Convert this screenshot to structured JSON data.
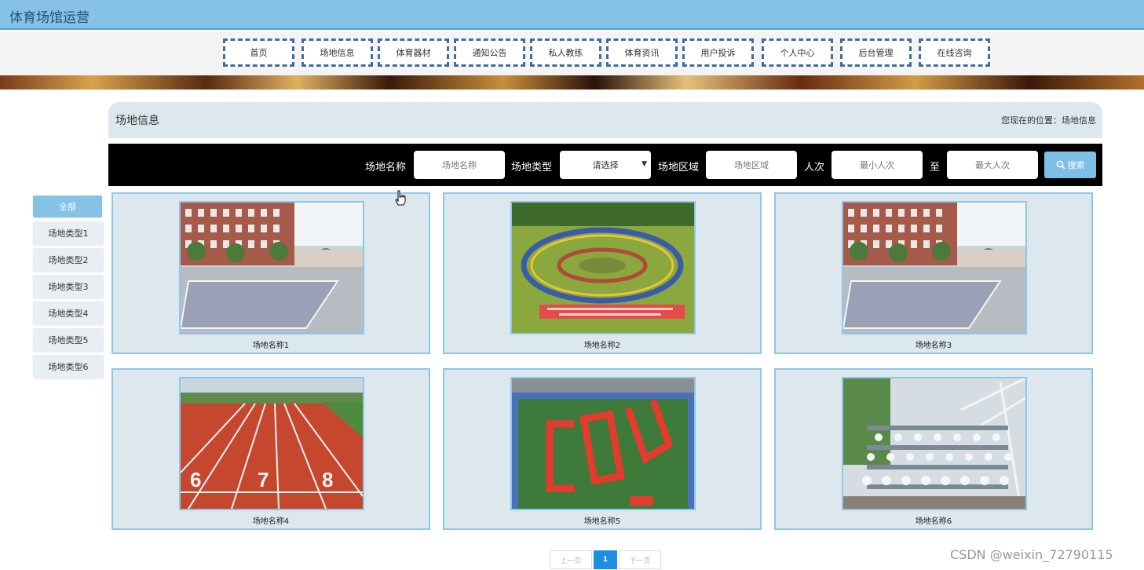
{
  "app": {
    "title": "体育场馆运营"
  },
  "nav": {
    "items": [
      "首页",
      "场地信息",
      "体育器材",
      "通知公告",
      "私人教练",
      "体育资讯",
      "用户投诉",
      "个人中心",
      "后台管理",
      "在线咨询"
    ]
  },
  "header": {
    "title": "场地信息",
    "location_label": "您现在的位置：",
    "location_value": "场地信息"
  },
  "search": {
    "name_label": "场地名称",
    "name_placeholder": "场地名称",
    "type_label": "场地类型",
    "type_selected": "请选择",
    "area_label": "场地区域",
    "area_placeholder": "场地区域",
    "count_label": "人次",
    "min_placeholder": "最小人次",
    "to_label": "至",
    "max_placeholder": "最大人次",
    "button_label": "搜索"
  },
  "sidebar": {
    "items": [
      "全部",
      "场地类型1",
      "场地类型2",
      "场地类型3",
      "场地类型4",
      "场地类型5",
      "场地类型6"
    ],
    "active_index": 0
  },
  "cards": [
    {
      "name": "场地名称1",
      "image": "building-court"
    },
    {
      "name": "场地名称2",
      "image": "crowd-circle-on-grass"
    },
    {
      "name": "场地名称3",
      "image": "building-court"
    },
    {
      "name": "场地名称4",
      "image": "running-track"
    },
    {
      "name": "场地名称5",
      "image": "aerial-letters-on-field"
    },
    {
      "name": "场地名称6",
      "image": "group-on-bleachers"
    }
  ],
  "pagination": {
    "prev": "上一页",
    "current": "1",
    "next": "下一页"
  },
  "watermark": "CSDN @weixin_72790115",
  "colors": {
    "accent": "#85c2e6",
    "nav_border": "#3f6da0",
    "panel": "#dde7ee",
    "card_border": "#8ec7ea",
    "page_active": "#1e8fe0"
  }
}
